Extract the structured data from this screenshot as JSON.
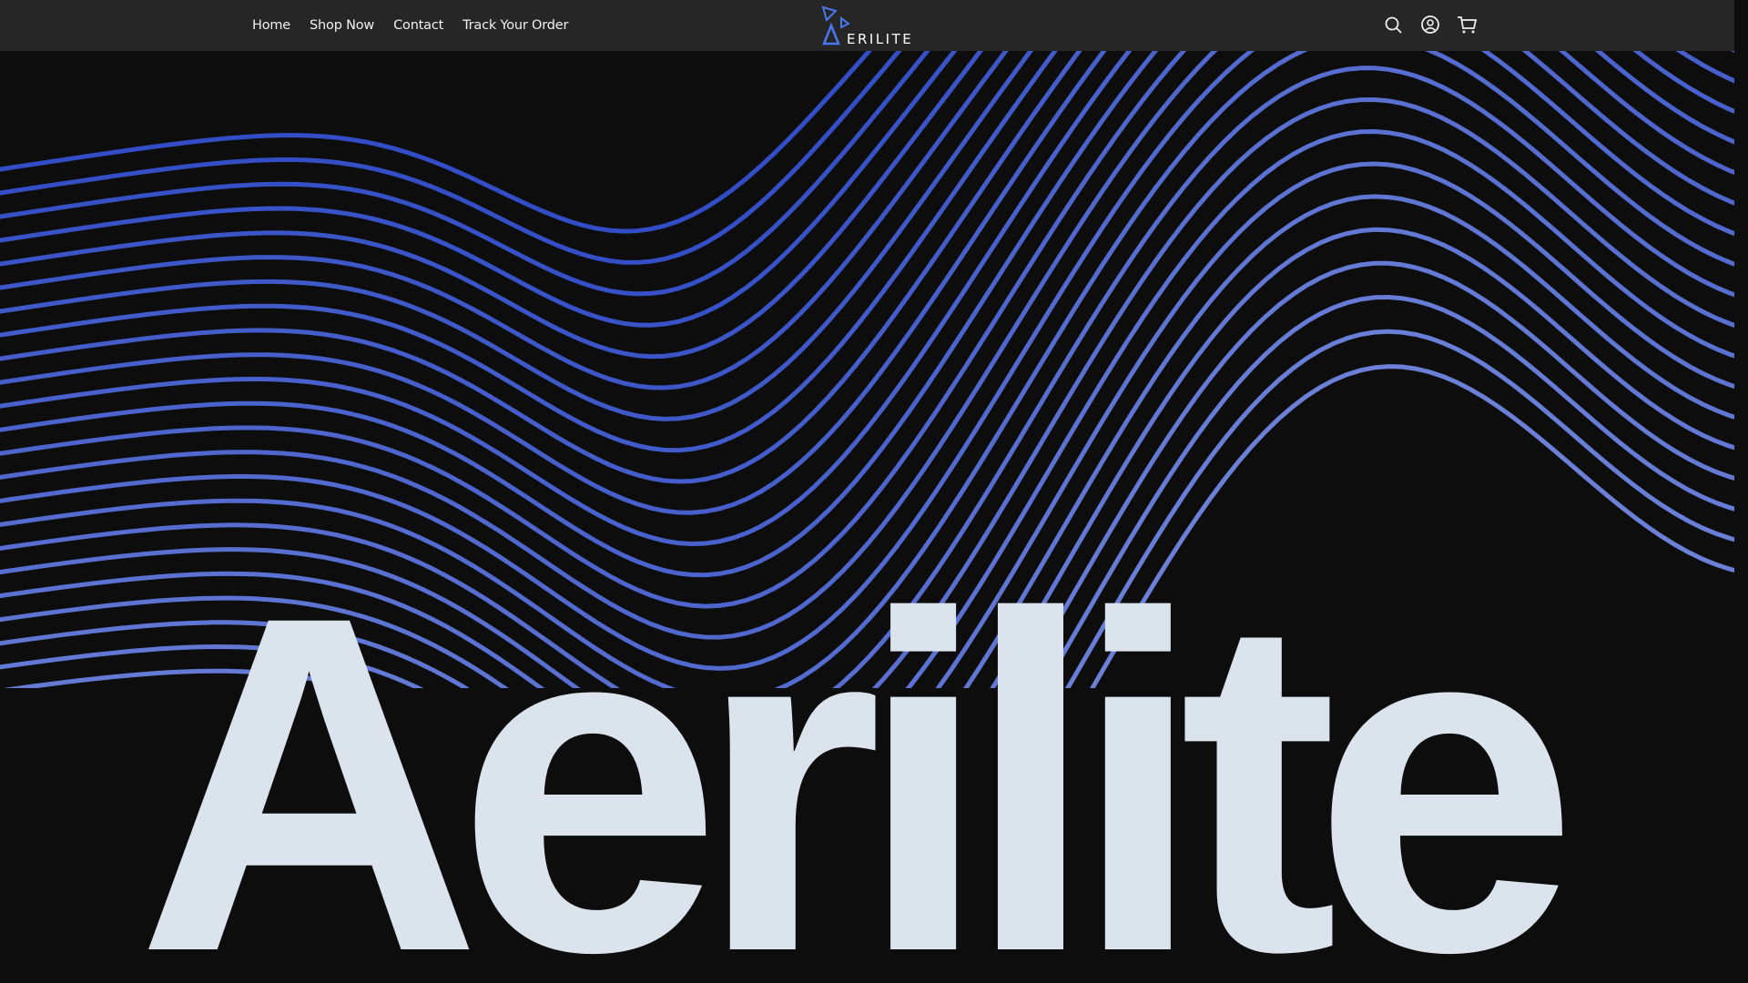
{
  "header": {
    "nav": [
      "Home",
      "Shop Now",
      "Contact",
      "Track Your Order"
    ],
    "logo_text": "ERILITE",
    "icons": [
      "search-icon",
      "account-icon",
      "cart-icon"
    ]
  },
  "hero": {
    "headline": "Aerilite"
  },
  "colors": {
    "header_bg": "#262626",
    "page_bg": "#0d0d0d",
    "accent": "#3a62e0",
    "wave_start": "#2340c0",
    "wave_end": "#b4c0ee",
    "headline": "#dbe3ec"
  }
}
